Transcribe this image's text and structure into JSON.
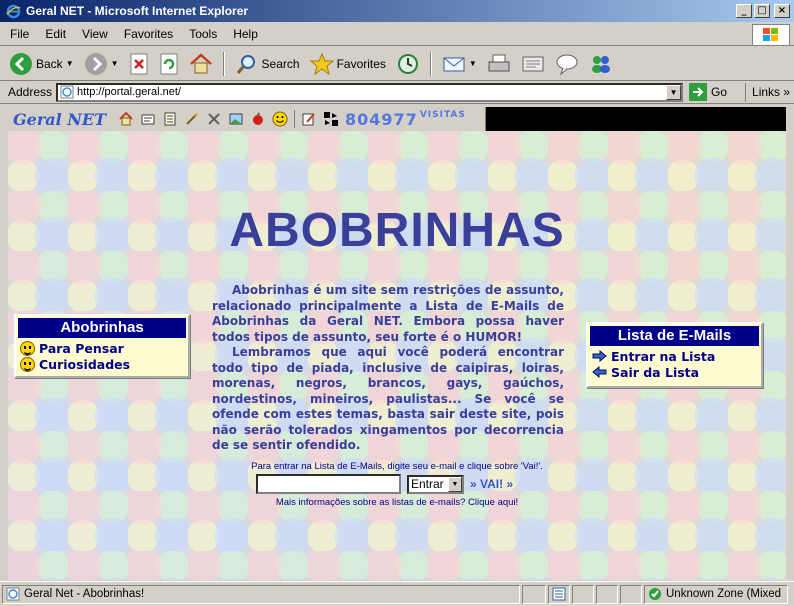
{
  "window": {
    "title": "Geral NET - Microsoft Internet Explorer"
  },
  "menu": [
    "File",
    "Edit",
    "View",
    "Favorites",
    "Tools",
    "Help"
  ],
  "toolbar": {
    "back": "Back",
    "search": "Search",
    "favorites": "Favorites"
  },
  "address": {
    "label": "Address",
    "url": "http://portal.geral.net/",
    "go": "Go",
    "links": "Links"
  },
  "sitebar": {
    "logo": "Geral NET",
    "counter": "804977",
    "counter_label": "VISITAS"
  },
  "page": {
    "headline": "ABOBRINHAS",
    "intro_p1": "Abobrinhas é um site sem restrições de assunto, relacionado principalmente a Lista de E-Mails de Abobrinhas da Geral NET. Embora possa haver todos tipos de assunto, seu forte é o HUMOR!",
    "intro_p2": "Lembramos que aqui você poderá encontrar todo tipo de piada, inclusive de caipiras, loiras, morenas, negros, brancos, gays, gaúchos, nordestinos, mineiros, paulistas... Se você se ofende com estes temas, basta sair deste site, pois não serão tolerados xingamentos por decorrencia de se sentir ofendido.",
    "left_panel": {
      "title": "Abobrinhas",
      "items": [
        "Para Pensar",
        "Curiosidades"
      ]
    },
    "right_panel": {
      "title": "Lista de E-Mails",
      "items": [
        "Entrar na Lista",
        "Sair da Lista"
      ]
    },
    "instructions": "Para entrar na Lista de E-Mails, digite seu e-mail e clique sobre 'Vai!'.",
    "select_value": "Entrar",
    "vai": "» VAI! »",
    "more_info": "Mais informações sobre as listas de e-mails? Clique aqui!"
  },
  "status": {
    "text": "Geral Net - Abobrinhas!",
    "zone": "Unknown Zone (Mixed"
  },
  "colors": {
    "title_blue": "#3a3f9a",
    "panel_header": "#000088",
    "panel_bg": "#fffbd0"
  }
}
